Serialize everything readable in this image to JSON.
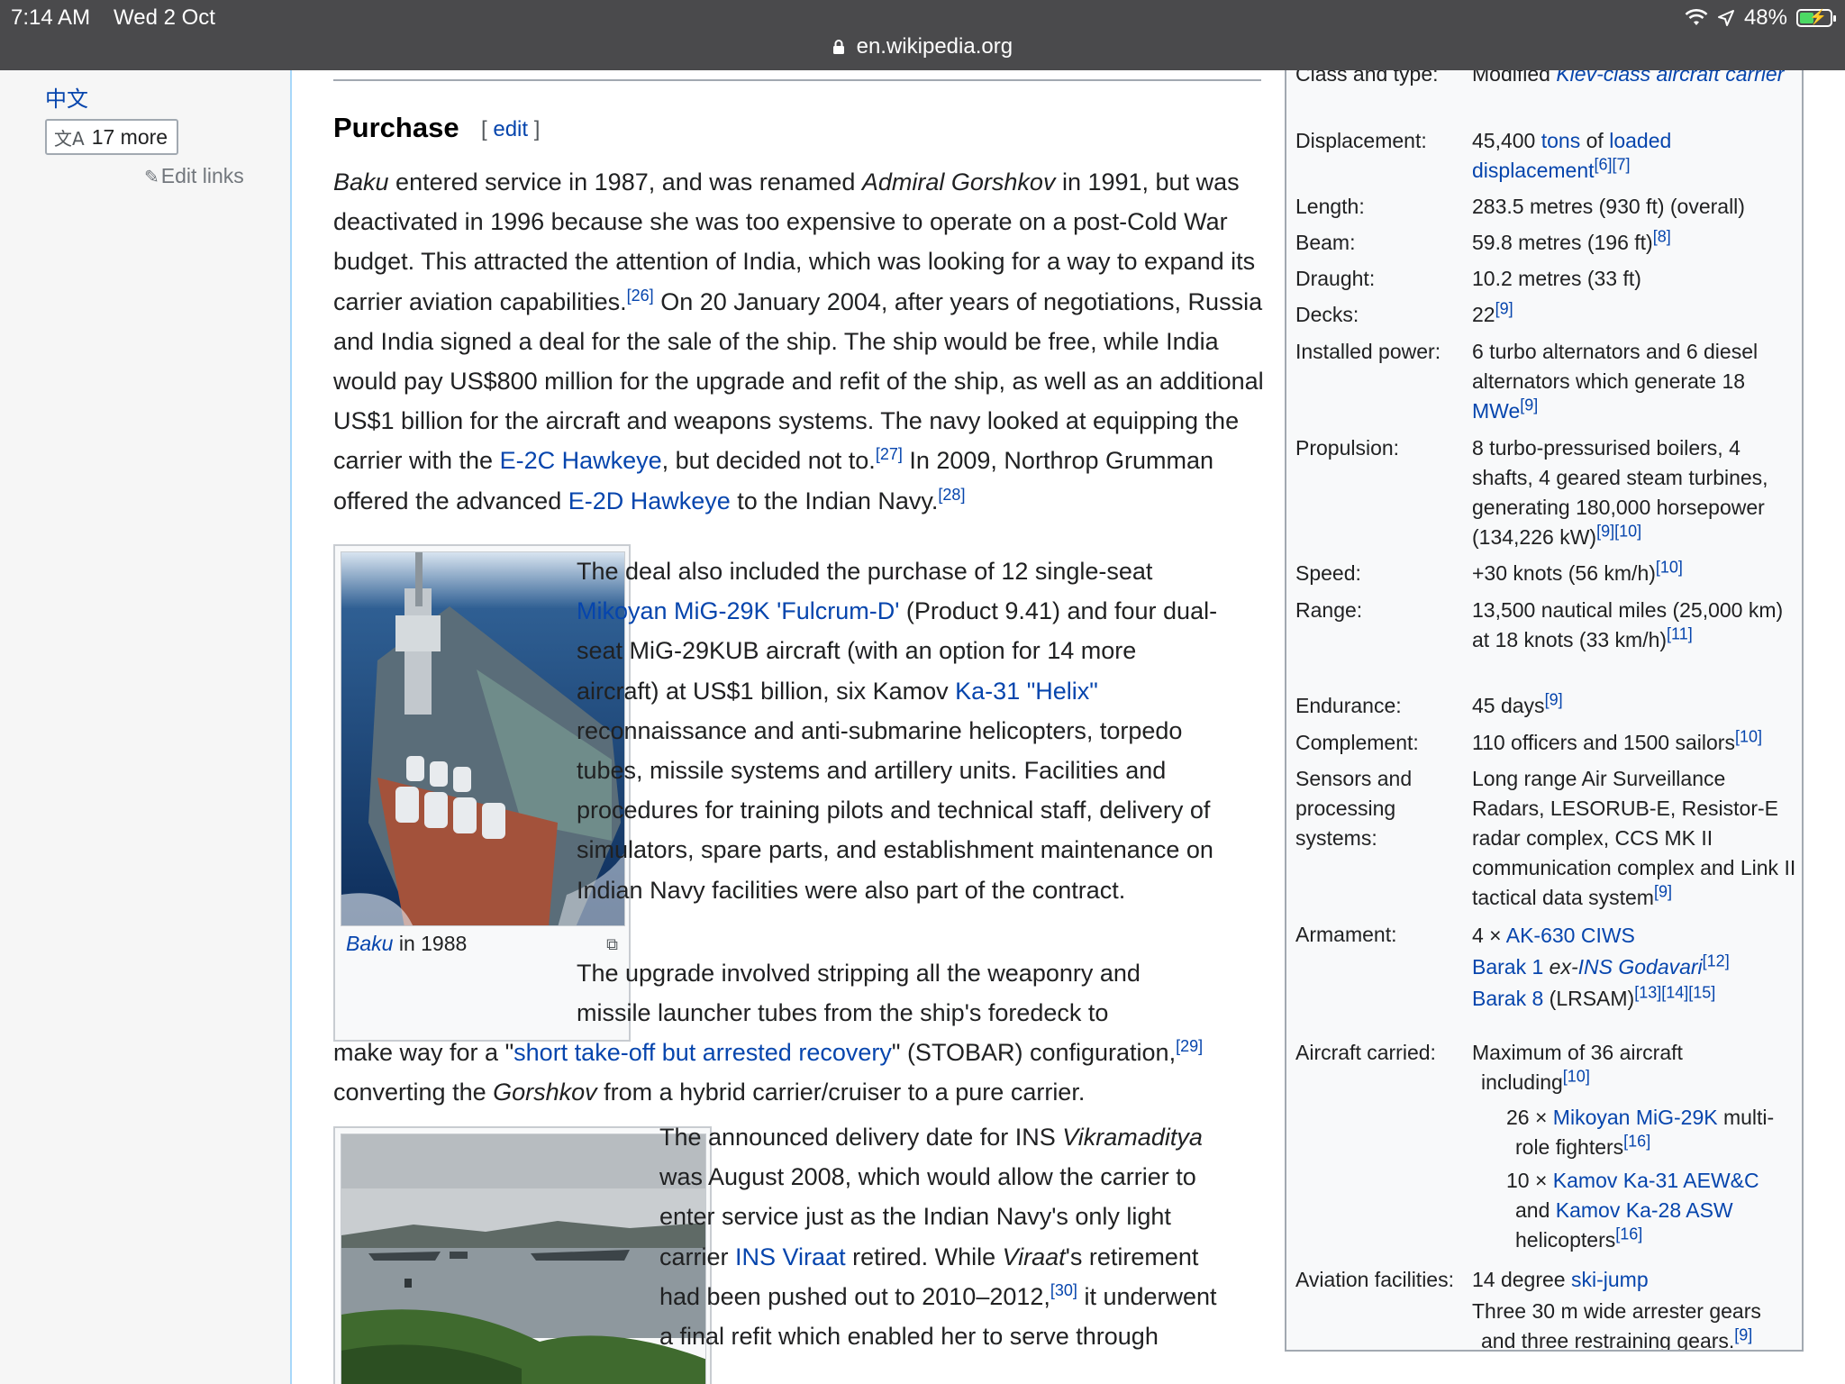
{
  "status_bar": {
    "time": "7:14 AM",
    "date": "Wed 2 Oct",
    "battery": "48%",
    "battery_level": 0.48,
    "url": "en.wikipedia.org"
  },
  "sidebar": {
    "lang_zh": "中文",
    "more_languages": "17 more",
    "edit_links": "Edit links"
  },
  "section": {
    "heading": "Purchase",
    "edit_open": "[ ",
    "edit_label": "edit",
    "edit_close": " ]"
  },
  "p1": {
    "t1": "Baku",
    "t2": " entered service in 1987, and was renamed ",
    "t3": "Admiral Gorshkov",
    "t4": " in 1991, but was deactivated in 1996 because she was too expensive to operate on a post-Cold War budget. This attracted the attention of India, which was looking for a way to expand its carrier aviation capabilities.",
    "r26": "[26]",
    "t5": " On 20 January 2004, after years of negotiations, Russia and India signed a deal for the sale of the ship. The ship would be free, while India would pay US$800 million for the upgrade and refit of the ship, as well as an additional US$1 billion for the aircraft and weapons systems. The navy looked at equipping the carrier with the ",
    "link_e2c": "E-2C Hawkeye",
    "t6": ", but decided not to.",
    "r27": "[27]",
    "t7": " In 2009, Northrop Grumman offered the advanced ",
    "link_e2d": "E-2D Hawkeye",
    "t8": " to the Indian Navy.",
    "r28": "[28]"
  },
  "p2": {
    "t1": "The deal also included the purchase of 12 single-seat ",
    "link_mig": "Mikoyan MiG-29K 'Fulcrum-D'",
    "t2": " (Product 9.41) and four dual-seat MiG-29KUB aircraft (with an option for 14 more aircraft) at US$1 billion, six Kamov ",
    "link_ka31": "Ka-31 \"Helix\"",
    "t3": " reconnaissance and anti-submarine helicopters, torpedo tubes, missile systems and artillery units. Facilities and procedures for training pilots and technical staff, delivery of simulators, spare parts, and establishment maintenance on Indian Navy facilities were also part of the contract."
  },
  "p3": {
    "t1": "The upgrade involved stripping all the weaponry and missile launcher tubes from the ship's foredeck to",
    "t2": "make way for a \"",
    "link_stobar": "short take-off but arrested recovery",
    "t3": "\" (STOBAR) configuration,",
    "r29": "[29]",
    "t4": " converting the ",
    "t5": "Gorshkov",
    "t6": " from a hybrid carrier/cruiser to a pure carrier."
  },
  "p4": {
    "t1": "The announced delivery date for INS ",
    "t2": "Vikramaditya",
    "t3": " was August 2008, which would allow the carrier to enter service just as the Indian Navy's only light carrier ",
    "link_viraat": "INS Viraat",
    "t4": " retired. While ",
    "t5": "Viraat",
    "t6": "'s retirement had been pushed out to 2010–2012,",
    "r30": "[30]",
    "t7": " it underwent a final refit which enabled her to serve through"
  },
  "thumb1": {
    "caption_link": "Baku",
    "caption_rest": " in 1988"
  },
  "infobox": {
    "class": {
      "label": "Class and type:",
      "t1": "Modified ",
      "link": "Kiev-class aircraft carrier"
    },
    "displacement": {
      "label": "Displacement:",
      "t1": "45,400 ",
      "link_tons": "tons",
      "t2": " of ",
      "link_loaded": "loaded displacement",
      "refs": "[6][7]"
    },
    "length": {
      "label": "Length:",
      "value": "283.5 metres (930 ft) (overall)"
    },
    "beam": {
      "label": "Beam:",
      "value": "59.8 metres (196 ft)",
      "refs": "[8]"
    },
    "draught": {
      "label": "Draught:",
      "value": "10.2 metres (33 ft)"
    },
    "decks": {
      "label": "Decks:",
      "value": "22",
      "refs": "[9]"
    },
    "power": {
      "label": "Installed power:",
      "value": "6 turbo alternators and 6 diesel alternators which generate 18 ",
      "link": "MWe",
      "refs": "[9]"
    },
    "propulsion": {
      "label": "Propulsion:",
      "value": "8 turbo-pressurised boilers, 4 shafts, 4 geared steam turbines, generating 180,000 horsepower (134,226 kW)",
      "refs": "[9][10]"
    },
    "speed": {
      "label": "Speed:",
      "value": "+30 knots (56 km/h)",
      "refs": "[10]"
    },
    "range": {
      "label": "Range:",
      "value": "13,500 nautical miles (25,000 km) at 18 knots (33 km/h)",
      "refs": "[11]"
    },
    "endurance": {
      "label": "Endurance:",
      "value": "45 days",
      "refs": "[9]"
    },
    "complement": {
      "label": "Complement:",
      "value": "110 officers and 1500 sailors",
      "refs": "[10]"
    },
    "sensors": {
      "label": "Sensors and processing systems:",
      "value": "Long range Air Surveillance Radars, LESORUB-E, Resistor-E radar complex, CCS MK II communication complex and Link II tactical data system",
      "refs": "[9]"
    },
    "armament": {
      "label": "Armament:",
      "l1_pre": "4 × ",
      "l1_link": "AK-630 CIWS",
      "l2_link": "Barak 1",
      "l2_mid": " ex-",
      "l2_link2": "INS Godavari",
      "l2_refs": "[12]",
      "l3_link": "Barak 8",
      "l3_rest": " (LRSAM)",
      "l3_refs": "[13][14][15]"
    },
    "aircraft": {
      "label": "Aircraft carried:",
      "l1": "Maximum of 36 aircraft including",
      "l1_refs": "[10]",
      "l2_pre": "26 × ",
      "l2_link": "Mikoyan MiG-29K",
      "l2_rest": " multi-role fighters",
      "l2_refs": "[16]",
      "l3_pre": "10 × ",
      "l3_link": "Kamov Ka-31 AEW&C",
      "l3_mid": " and ",
      "l3_link2": "Kamov Ka-28 ASW",
      "l3_rest": " helicopters",
      "l3_refs": "[16]"
    },
    "facilities": {
      "label": "Aviation facilities:",
      "l1_pre": "14 degree ",
      "l1_link": "ski-jump",
      "l2": "Three 30 m wide arrester gears and three restraining gears.",
      "l2_refs": "[9]"
    }
  },
  "colors": {
    "link": "#0645ad",
    "text": "#202122",
    "infobox_bg": "#f8f9fa",
    "status_bar": "#4a4a4c",
    "battery": "#4cd964"
  },
  "icons": [
    "lock-icon",
    "wifi-icon",
    "location-arrow-icon",
    "battery-icon",
    "translate-icon",
    "pencil-icon",
    "enlarge-icon"
  ]
}
